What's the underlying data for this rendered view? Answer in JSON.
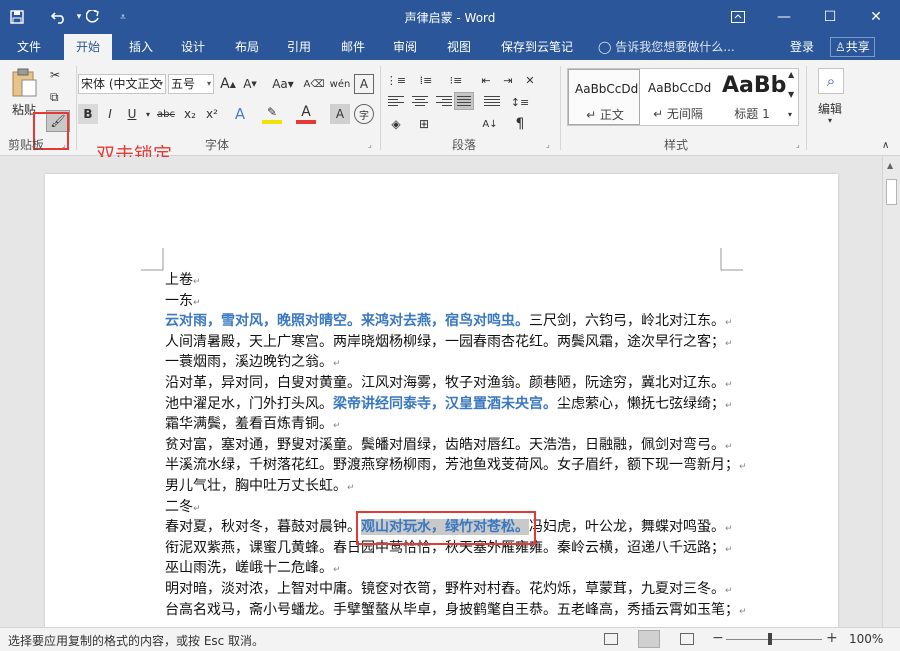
{
  "window": {
    "title": "声律启蒙 - Word",
    "controls": {
      "restore_icon": "ribbon-display-icon",
      "minimize": "—",
      "maximize": "☐",
      "close": "✕"
    }
  },
  "quick_access": {
    "save": "save-icon",
    "undo": "undo-icon",
    "redo": "redo-icon",
    "customize": "customize-icon"
  },
  "tabs": [
    "文件",
    "开始",
    "插入",
    "设计",
    "布局",
    "引用",
    "邮件",
    "审阅",
    "视图",
    "保存到云笔记"
  ],
  "active_tab": "开始",
  "tell_me": "告诉我您想要做什么...",
  "account": {
    "login": "登录",
    "share": "共享"
  },
  "ribbon": {
    "clipboard": {
      "paste_label": "粘贴",
      "group_label": "剪贴板"
    },
    "font": {
      "name": "宋体 (中文正文",
      "size": "五号",
      "group_label": "字体",
      "buttons": [
        "B",
        "I",
        "U",
        "abc",
        "x₂",
        "x²"
      ]
    },
    "paragraph": {
      "group_label": "段落"
    },
    "styles": {
      "group_label": "样式",
      "items": [
        {
          "preview": "AaBbCcDd",
          "name": "↵ 正文"
        },
        {
          "preview": "AaBbCcDd",
          "name": "↵ 无间隔"
        },
        {
          "preview": "AaBb",
          "name": "标题 1"
        }
      ]
    },
    "editing": {
      "label": "编辑"
    }
  },
  "annotation": {
    "text": "双击锁定",
    "color": "#e53935"
  },
  "document": {
    "lines": [
      [
        {
          "t": "上卷"
        }
      ],
      [
        {
          "t": "一东"
        }
      ],
      [
        {
          "t": "云对雨，雪对风，晚照对晴空。来鸿对去燕，宿鸟对鸣虫。",
          "s": "hl"
        },
        {
          "t": "三尺剑，六钧弓，岭北对江东。"
        }
      ],
      [
        {
          "t": "人间清暑殿，天上广寒宫。两岸晓烟杨柳绿，一园春雨杏花红。两鬓风霜，途次早行之客；"
        }
      ],
      [
        {
          "t": "一蓑烟雨，溪边晚钓之翁。"
        }
      ],
      [
        {
          "t": "沿对革，异对同，白叟对黄童。江风对海雾，牧子对渔翁。颜巷陋，阮途穷，冀北对辽东。"
        }
      ],
      [
        {
          "t": "池中濯足水，门外打头风。"
        },
        {
          "t": "梁帝讲经同泰寺，汉皇置酒未央宫。",
          "s": "hl"
        },
        {
          "t": "尘虑萦心，懒抚七弦绿绮；"
        }
      ],
      [
        {
          "t": "霜华满鬓，羞看百炼青铜。"
        }
      ],
      [
        {
          "t": "贫对富，塞对通，野叟对溪童。鬓皤对眉绿，齿皓对唇红。天浩浩，日融融，佩剑对弯弓。"
        }
      ],
      [
        {
          "t": "半溪流水绿，千树落花红。野渡燕穿杨柳雨，芳池鱼戏芰荷风。女子眉纤，额下现一弯新月；"
        }
      ],
      [
        {
          "t": "男儿气壮，胸中吐万丈长虹。"
        }
      ],
      [
        {
          "t": "二冬"
        }
      ],
      [
        {
          "t": "春对夏，秋对冬，暮鼓对晨钟。"
        },
        {
          "t": "观山对玩水，绿竹对苍松。",
          "s": "sel"
        },
        {
          "t": "冯妇虎，叶公龙，舞蝶对鸣蛩。"
        }
      ],
      [
        {
          "t": "衔泥双紫燕，课蜜几黄蜂。春日园中莺恰恰，秋天塞外雁雍雍。秦岭云横，迢递八千远路；"
        }
      ],
      [
        {
          "t": "巫山雨洗，嵯峨十二危峰。"
        }
      ],
      [
        {
          "t": "明对暗，淡对浓，上智对中庸。镜奁对衣笥，野杵对村舂。花灼烁，草蒙茸，九夏对三冬。"
        }
      ],
      [
        {
          "t": "台高名戏马，斋小号蟠龙。手擘蟹螯从毕卓，身披鹤氅自王恭。五老峰高，秀插云霄如玉笔；"
        }
      ]
    ]
  },
  "status_bar": {
    "text": "选择要应用复制的格式的内容，或按 Esc 取消。",
    "zoom": "100%"
  },
  "colors": {
    "accent": "#2b579a",
    "highlight_text": "#3a78c2",
    "annotation": "#e53935"
  }
}
